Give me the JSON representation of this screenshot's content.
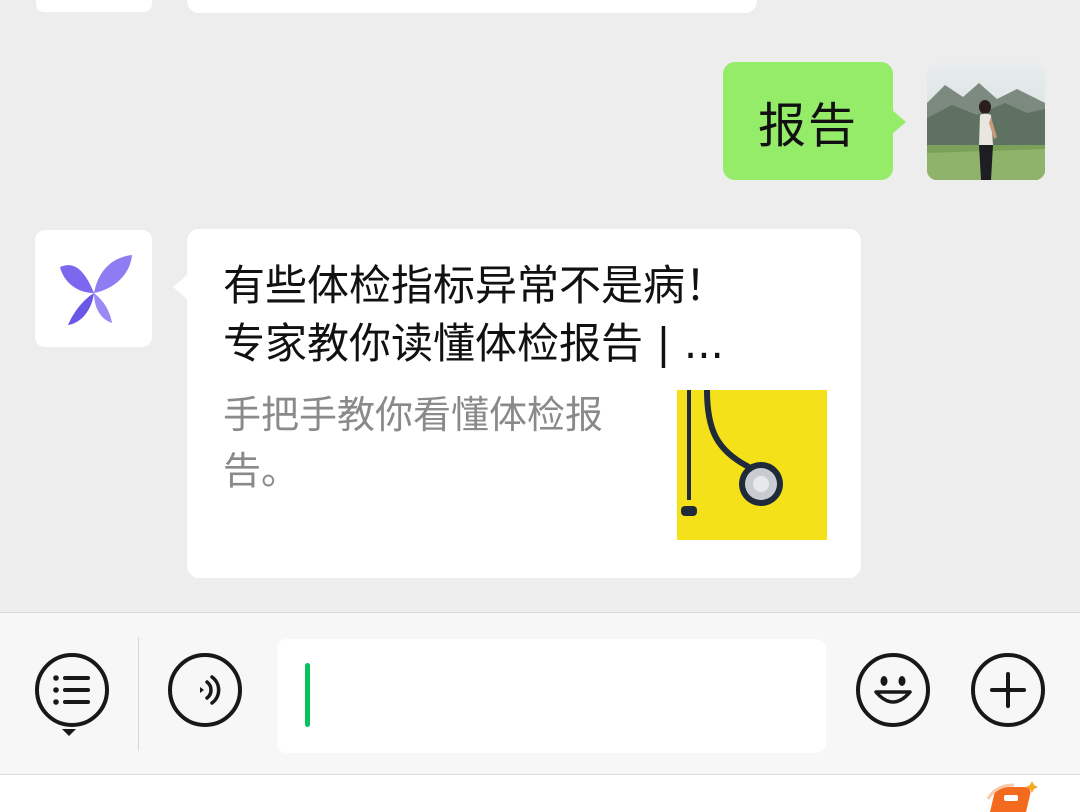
{
  "messages": {
    "outgoing": {
      "text": "报告"
    },
    "incoming": {
      "card_title": "有些体检指标异常不是病！专家教你读懂体检报告 | ...",
      "card_desc": "手把手教你看懂体检报告。"
    }
  },
  "input": {
    "value": ""
  },
  "icons": {
    "menu": "list-menu-icon",
    "voice": "voice-icon",
    "emoji": "emoji-icon",
    "plus": "plus-icon",
    "bot_avatar": "butterfly-logo-icon",
    "ime": "keyboard-ime-icon"
  },
  "colors": {
    "chat_background": "#ededed",
    "outgoing_bubble": "#95ec69",
    "incoming_bubble": "#ffffff",
    "cursor": "#07c160",
    "description_text": "#8a8a8a",
    "butterfly_logo": "#7b68ee",
    "thumbnail_background": "#f5e11a"
  }
}
